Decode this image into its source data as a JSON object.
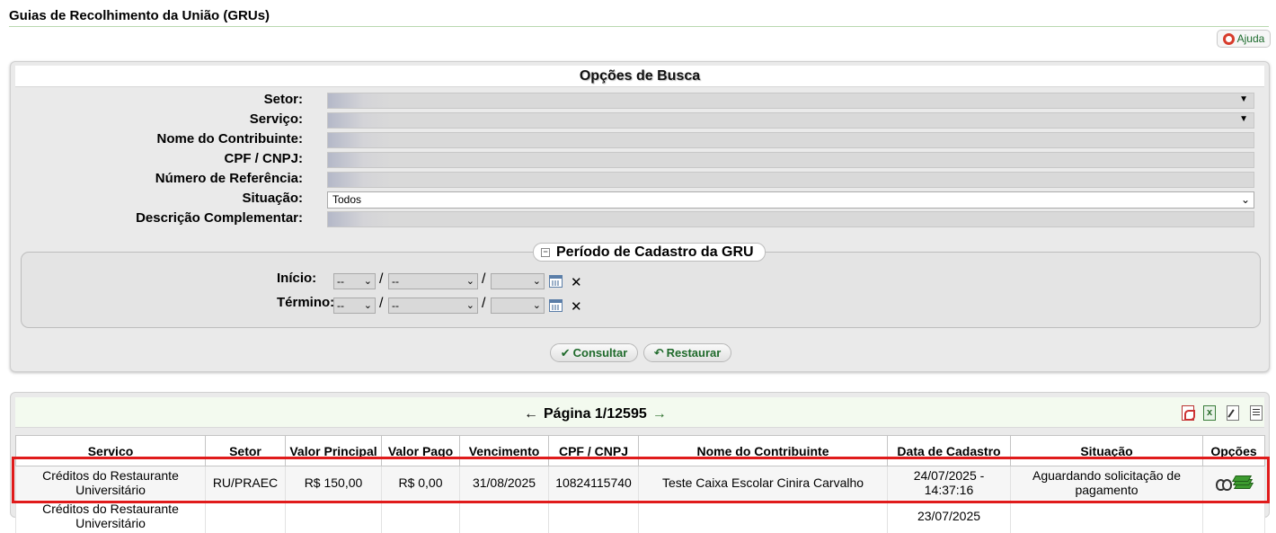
{
  "page": {
    "title": "Guias de Recolhimento da União (GRUs)",
    "help_label": "Ajuda"
  },
  "search": {
    "title": "Opções de Busca",
    "fields": {
      "setor": {
        "label": "Setor:",
        "value": ""
      },
      "servico": {
        "label": "Serviço:",
        "value": ""
      },
      "contribuinte": {
        "label": "Nome do Contribuinte:",
        "value": ""
      },
      "cpf": {
        "label": "CPF / CNPJ:",
        "value": ""
      },
      "referencia": {
        "label": "Número de Referência:",
        "value": ""
      },
      "situacao": {
        "label": "Situação:",
        "value": "Todos"
      },
      "descricao": {
        "label": "Descrição Complementar:",
        "value": ""
      }
    },
    "period": {
      "legend": "Período de Cadastro da GRU",
      "toggle": "−",
      "start_label": "Início:",
      "end_label": "Término:",
      "day_value": "--",
      "month_value": "--",
      "year_value": "",
      "separator": "/",
      "clear": "✕"
    },
    "buttons": {
      "search": "Consultar",
      "reset": "Restaurar"
    }
  },
  "results": {
    "pager": {
      "prev": "←",
      "label": "Página 1/12595",
      "next": "→"
    },
    "columns": [
      "Servico",
      "Setor",
      "Valor Principal",
      "Valor Pago",
      "Vencimento",
      "CPF / CNPJ",
      "Nome do Contribuinte",
      "Data de Cadastro",
      "Situação",
      "Opções"
    ],
    "rows": [
      {
        "servico": "Créditos do Restaurante Universitário",
        "setor": "RU/PRAEC",
        "valor_principal": "R$ 150,00",
        "valor_pago": "R$ 0,00",
        "vencimento": "31/08/2025",
        "cpf": "10824115740",
        "contribuinte": "Teste Caixa Escolar Cinira Carvalho",
        "data_cadastro": "24/07/2025 - 14:37:16",
        "situacao": "Aguardando solicitação de pagamento"
      },
      {
        "servico": "Créditos do Restaurante Universitário",
        "setor": "",
        "valor_principal": "",
        "valor_pago": "",
        "vencimento": "",
        "cpf": "",
        "contribuinte": "",
        "data_cadastro": "23/07/2025",
        "situacao": ""
      }
    ]
  },
  "colors": {
    "accent_green": "#1f6a2b",
    "highlight_red": "#e01b1b",
    "panel_bg": "#eaeaea"
  }
}
